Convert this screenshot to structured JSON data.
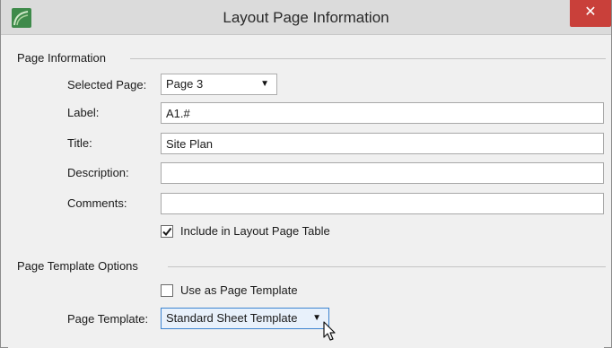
{
  "window": {
    "title": "Layout Page Information",
    "close_glyph": "✕"
  },
  "page_information": {
    "group_label": "Page Information",
    "selected_page_label": "Selected Page:",
    "selected_page_value": "Page 3",
    "label_label": "Label:",
    "label_value": "A1.#",
    "title_label": "Title:",
    "title_value": "Site Plan",
    "description_label": "Description:",
    "description_value": "",
    "comments_label": "Comments:",
    "comments_value": "",
    "include_label": "Include in Layout Page Table",
    "include_checked": true
  },
  "page_template_options": {
    "group_label": "Page Template Options",
    "use_as_template_label": "Use as Page Template",
    "use_as_template_checked": false,
    "page_template_label": "Page Template:",
    "page_template_value": "Standard Sheet Template"
  },
  "icons": {
    "app": "app-logo-icon",
    "close": "close-icon",
    "dropdown": "chevron-down-icon",
    "check": "checkmark-icon",
    "cursor": "mouse-pointer-icon"
  },
  "colors": {
    "close_button": "#c9403a",
    "app_icon": "#3e8a4a",
    "focus_border": "#3c84d0"
  }
}
